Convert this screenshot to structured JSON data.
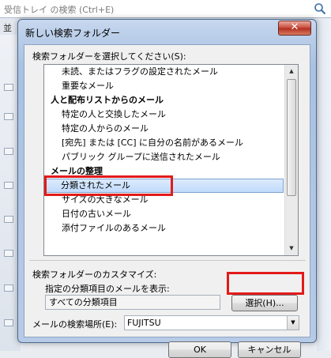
{
  "background": {
    "search_placeholder": "受信トレイ の検索 (Ctrl+E)",
    "tab_label": "並"
  },
  "dialog": {
    "title": "新しい検索フォルダー",
    "close_symbol": "✕",
    "select_label": "検索フォルダーを選択してください(S):",
    "list": [
      {
        "text": "未読、またはフラグの設定されたメール",
        "kind": "item"
      },
      {
        "text": "重要なメール",
        "kind": "item"
      },
      {
        "text": "人と配布リストからのメール",
        "kind": "header"
      },
      {
        "text": "特定の人と交換したメール",
        "kind": "item"
      },
      {
        "text": "特定の人からのメール",
        "kind": "item"
      },
      {
        "text": "[宛先] または [CC] に自分の名前があるメール",
        "kind": "item"
      },
      {
        "text": "パブリック グループに送信されたメール",
        "kind": "item"
      },
      {
        "text": "メールの整理",
        "kind": "header"
      },
      {
        "text": "分類されたメール",
        "kind": "selected"
      },
      {
        "text": "サイズの大きなメール",
        "kind": "item"
      },
      {
        "text": "日付の古いメール",
        "kind": "item"
      },
      {
        "text": "添付ファイルのあるメール",
        "kind": "item"
      }
    ],
    "customize_label": "検索フォルダーのカスタマイズ:",
    "category_prompt": "指定の分類項目のメールを表示:",
    "category_value": "すべての分類項目",
    "select_button": "選択(H)...",
    "location_label": "メールの検索場所(E):",
    "location_value": "FUJITSU",
    "ok_button": "OK",
    "cancel_button": "キャンセル"
  },
  "colors": {
    "highlight_box": "#e21a1a",
    "selection": "#c1dbfc"
  }
}
